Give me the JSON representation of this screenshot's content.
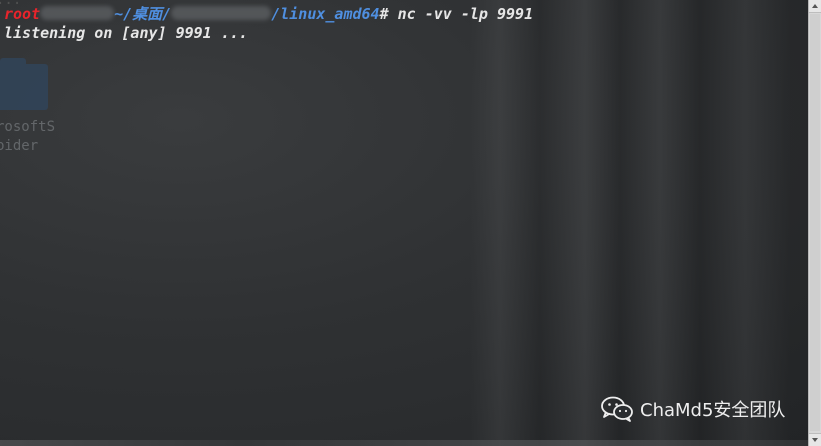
{
  "terminal": {
    "prompt_user": "root",
    "prompt_path_mid": "~/桌面/",
    "prompt_path_end": "/linux_amd64",
    "prompt_symbol": "#",
    "command": "nc -vv -lp 9991",
    "output_line": "listening on [any] 9991 ..."
  },
  "desktop": {
    "icon_label_top": "...",
    "icon_label_1": "rosoftS",
    "icon_label_2": "bider",
    "folder_icon": "folder-icon"
  },
  "watermark": {
    "text": "ChaMd5安全团队",
    "icon": "wechat-icon"
  },
  "colors": {
    "prompt_user": "#e8242b",
    "prompt_path": "#4f8fe0",
    "terminal_text": "#e6e6e6"
  }
}
